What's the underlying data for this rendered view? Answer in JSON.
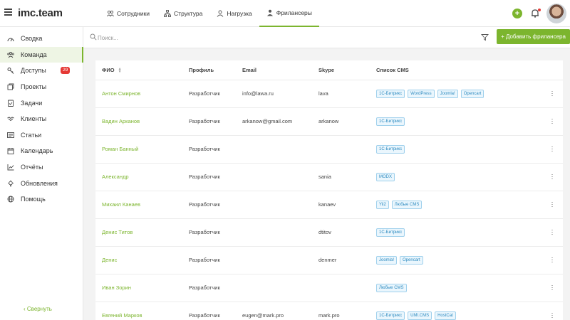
{
  "app": {
    "logo": "imc.team"
  },
  "topnav": {
    "tabs": [
      {
        "label": "Сотрудники",
        "icon": "people-icon"
      },
      {
        "label": "Структура",
        "icon": "structure-icon"
      },
      {
        "label": "Нагрузка",
        "icon": "person-icon"
      },
      {
        "label": "Фрилансеры",
        "icon": "freelancer-icon",
        "active": true
      }
    ]
  },
  "sidebar": {
    "items": [
      {
        "label": "Сводка",
        "icon": "dashboard-icon"
      },
      {
        "label": "Команда",
        "icon": "team-icon",
        "active": true
      },
      {
        "label": "Доступы",
        "icon": "key-icon",
        "badge": "29"
      },
      {
        "label": "Проекты",
        "icon": "projects-icon"
      },
      {
        "label": "Задачи",
        "icon": "tasks-icon"
      },
      {
        "label": "Клиенты",
        "icon": "handshake-icon"
      },
      {
        "label": "Статьи",
        "icon": "articles-icon"
      },
      {
        "label": "Календарь",
        "icon": "calendar-icon"
      },
      {
        "label": "Отчёты",
        "icon": "chart-icon"
      },
      {
        "label": "Обновления",
        "icon": "bulb-icon"
      },
      {
        "label": "Помощь",
        "icon": "globe-icon"
      }
    ],
    "collapse_label": "‹ Свернуть"
  },
  "search": {
    "placeholder": "Поиск..."
  },
  "add_button_label": "+ Добавить фрилансера",
  "table": {
    "headers": {
      "name": "ФИО",
      "profile": "Профиль",
      "email": "Email",
      "skype": "Skype",
      "cms": "Список CMS"
    },
    "rows": [
      {
        "name": "Антон Смирнов",
        "profile": "Разработчик",
        "email": "info@lawa.ru",
        "skype": "lava",
        "cms": [
          "1С-Битрикс",
          "WordPress",
          "Joomla!",
          "Opencart"
        ]
      },
      {
        "name": "Вадин Арканов",
        "profile": "Разработчик",
        "email": "arkanow@gmail.com",
        "skype": "arkanow",
        "cms": [
          "1С-Битрикс"
        ]
      },
      {
        "name": "Роман Банный",
        "profile": "Разработчик",
        "email": "",
        "skype": "",
        "cms": [
          "1С-Битрикс"
        ]
      },
      {
        "name": "Александр",
        "profile": "Разработчик",
        "email": "",
        "skype": "sania",
        "cms": [
          "MODX"
        ]
      },
      {
        "name": "Михаил Канаев",
        "profile": "Разработчик",
        "email": "",
        "skype": "kanaev",
        "cms": [
          "Yii2",
          "Любые CMS"
        ]
      },
      {
        "name": "Денис Титов",
        "profile": "Разработчик",
        "email": "",
        "skype": "dtitov",
        "cms": [
          "1С-Битрикс"
        ]
      },
      {
        "name": "Денис",
        "profile": "Разработчик",
        "email": "",
        "skype": "denmer",
        "cms": [
          "Joomla!",
          "Opencart"
        ]
      },
      {
        "name": "Иван Зорин",
        "profile": "Разработчик",
        "email": "",
        "skype": "",
        "cms": [
          "Любые CMS"
        ]
      },
      {
        "name": "Евгений Марков",
        "profile": "Разработчик",
        "email": "eugen@mark.pro",
        "skype": "mark.pro",
        "cms": [
          "1С-Битрикс",
          "UMI.CMS",
          "HostCat"
        ]
      }
    ]
  },
  "colors": {
    "accent": "#7cb52e",
    "badge": "#e53935",
    "tag_text": "#2e8bc0"
  }
}
